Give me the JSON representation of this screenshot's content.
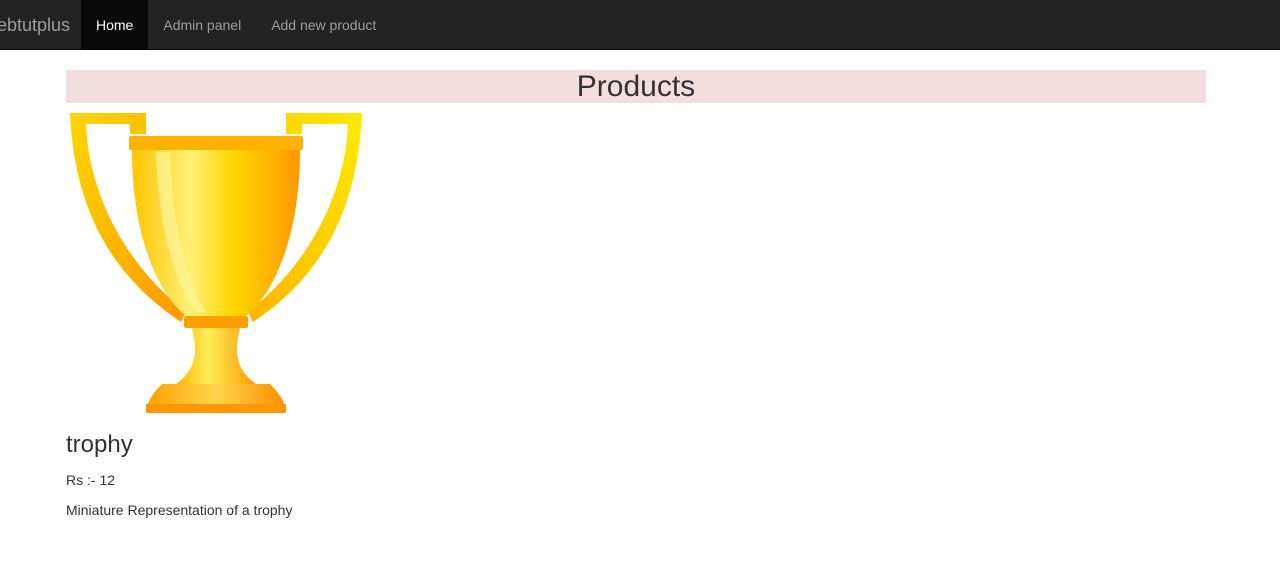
{
  "navbar": {
    "brand": "webtutplus",
    "items": [
      {
        "label": "Home",
        "active": true
      },
      {
        "label": "Admin panel",
        "active": false
      },
      {
        "label": "Add new product",
        "active": false
      }
    ]
  },
  "page": {
    "heading": "Products"
  },
  "products": [
    {
      "image_icon": "trophy-image",
      "name": "trophy",
      "price_text": "Rs :- 12",
      "description": "Miniature Representation of a trophy"
    }
  ],
  "colors": {
    "navbar_bg": "#222222",
    "active_nav_bg": "#080808",
    "banner_bg": "#f2dede",
    "trophy_gold": "#ffd700",
    "trophy_orange": "#ffa000"
  }
}
